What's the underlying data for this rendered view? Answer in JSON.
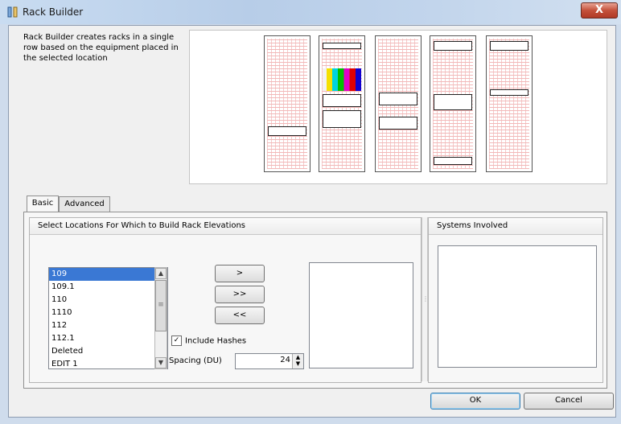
{
  "window": {
    "title": "Rack Builder",
    "close_label": "X"
  },
  "description": "Rack Builder  creates racks in a single row based on the equipment placed in the selected location",
  "tabs": [
    {
      "label": "Basic",
      "active": true
    },
    {
      "label": "Advanced",
      "active": false
    }
  ],
  "locations_group": {
    "title": "Select Locations For Which to Build Rack Elevations",
    "items": [
      "109",
      "109.1",
      "110",
      "1110",
      "112",
      "112.1",
      "Deleted",
      "EDIT 1"
    ],
    "selected": "109"
  },
  "move_buttons": {
    "add": ">",
    "add_all": ">>",
    "remove_all": "<<"
  },
  "include_hashes": {
    "label": "Include Hashes",
    "checked": true,
    "mark": "✓"
  },
  "spacing": {
    "label": "Spacing (DU)",
    "value": "24"
  },
  "systems_group": {
    "title": "Systems Involved"
  },
  "dialog_buttons": {
    "ok": "OK",
    "cancel": "Cancel"
  },
  "colors": {
    "selection": "#3a78d4",
    "titlebar": "#b7cde8",
    "close": "#c4513b"
  }
}
